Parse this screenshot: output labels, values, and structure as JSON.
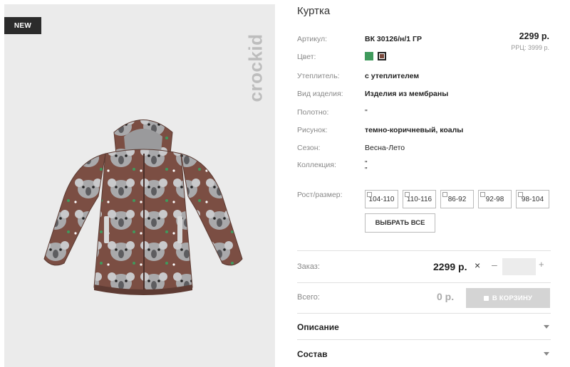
{
  "product": {
    "badge": "NEW",
    "brand": "crockid",
    "title": "Куртка",
    "price": "2299 р.",
    "rrp": "РРЦ: 3999 р."
  },
  "attributes": [
    {
      "label": "Артикул:",
      "value": "ВК 30126/н/1 ГР"
    },
    {
      "label": "Цвет:",
      "value": ""
    },
    {
      "label": "Утеплитель:",
      "value": "с утеплителем"
    },
    {
      "label": "Вид изделия:",
      "value": "Изделия из мембраны"
    },
    {
      "label": "Полотно:",
      "value": "\""
    },
    {
      "label": "Рисунок:",
      "value": "темно-коричневый, коалы"
    },
    {
      "label": "Сезон:",
      "value": "Весна-Лето"
    },
    {
      "label": "Коллекция:",
      "value": "\"\n\""
    }
  ],
  "colors": [
    {
      "name": "green",
      "hex": "#3f9a5c",
      "selected": false
    },
    {
      "name": "brown",
      "hex": "#7a4a3d",
      "selected": true
    }
  ],
  "sizes": {
    "label": "Рост/размер:",
    "options": [
      "104-110",
      "110-116",
      "86-92",
      "92-98",
      "98-104"
    ],
    "select_all": "ВЫБРАТЬ ВСЕ"
  },
  "order": {
    "label": "Заказ:",
    "price": "2299 р.",
    "times": "×",
    "minus": "–",
    "plus": "+",
    "qty": ""
  },
  "total": {
    "label": "Всего:",
    "value": "0 р.",
    "cart_button": "В КОРЗИНУ"
  },
  "accordions": [
    "Описание",
    "Состав"
  ]
}
